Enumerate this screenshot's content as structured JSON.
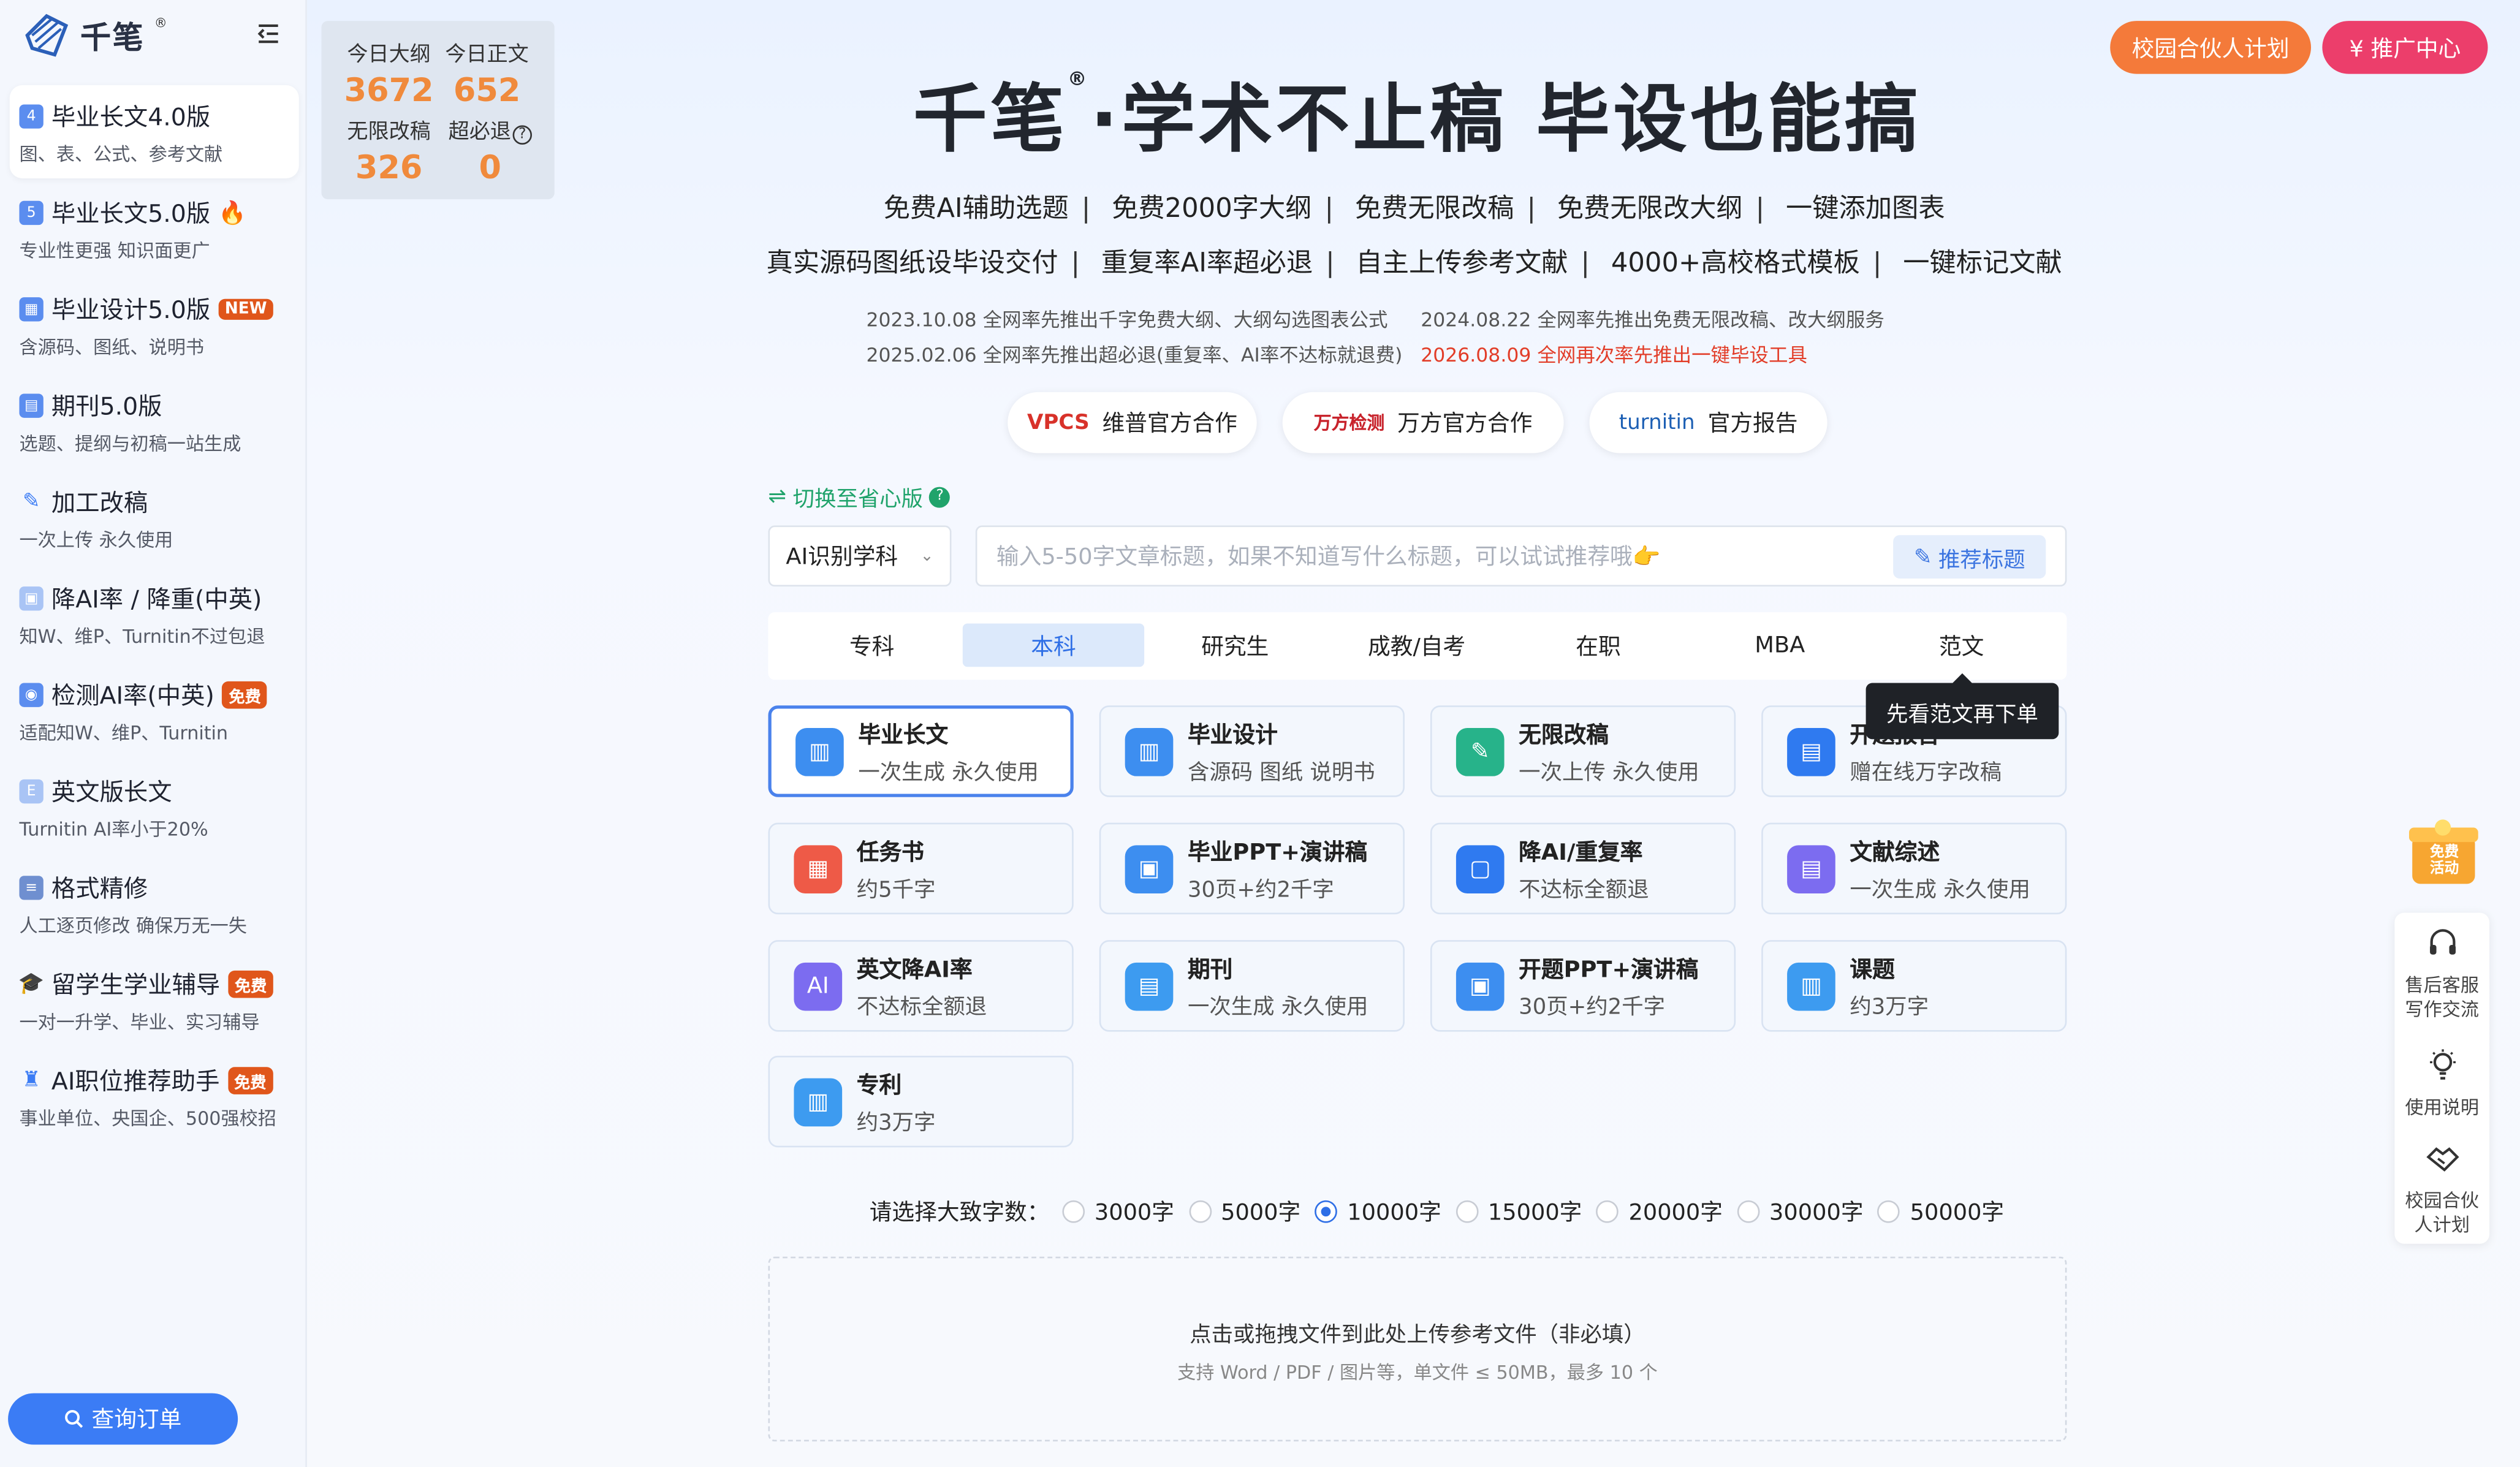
{
  "logo": {
    "text": "千笔",
    "reg": "®"
  },
  "sidebar": {
    "items": [
      {
        "label": "毕业长文4.0版",
        "sub": "图、表、公式、参考文献",
        "icon_text": "4"
      },
      {
        "label": "毕业长文5.0版",
        "sub": "专业性更强 知识面更广",
        "icon_text": "5"
      },
      {
        "label": "毕业设计5.0版",
        "sub": "含源码、图纸、说明书",
        "badge": "NEW"
      },
      {
        "label": "期刊5.0版",
        "sub": "选题、提纲与初稿一站生成"
      },
      {
        "label": "加工改稿",
        "sub": "一次上传 永久使用"
      },
      {
        "label": "降AI率 / 降重(中英)",
        "sub": "知W、维P、Turnitin不过包退"
      },
      {
        "label": "检测AI率(中英)",
        "sub": "适配知W、维P、Turnitin",
        "badge": "免费"
      },
      {
        "label": "英文版长文",
        "sub": "Turnitin AI率小于20%"
      },
      {
        "label": "格式精修",
        "sub": "人工逐页修改 确保万无一失"
      },
      {
        "label": "留学生学业辅导",
        "sub": "一对一升学、毕业、实习辅导",
        "badge": "免费"
      },
      {
        "label": "AI职位推荐助手",
        "sub": "事业单位、央国企、500强校招",
        "badge": "免费"
      }
    ],
    "query_button": "查询订单"
  },
  "stats": {
    "today_outline_label": "今日大纲",
    "today_outline_value": "3672",
    "today_text_label": "今日正文",
    "today_text_value": "652",
    "unlimited_label": "无限改稿",
    "unlimited_value": "326",
    "refund_label": "超必退",
    "refund_value": "0"
  },
  "top_buttons": {
    "campus": "校园合伙人计划",
    "promo": "¥  推广中心"
  },
  "hero": {
    "title_a": "千笔",
    "title_reg": "®",
    "title_b": "·学术不止稿  毕设也能搞",
    "features1": [
      "免费AI辅助选题",
      "免费2000字大纲",
      "免费无限改稿",
      "免费无限改大纲",
      "一键添加图表"
    ],
    "features2": [
      "真实源码图纸设毕设交付",
      "重复率AI率超必退",
      "自主上传参考文献",
      "4000+高校格式模板",
      "一键标记文献"
    ],
    "news": [
      "2023.10.08 全网率先推出千字免费大纲、大纲勾选图表公式",
      "2024.08.22 全网率先推出免费无限改稿、改大纲服务",
      "2025.02.06 全网率先推出超必退(重复率、AI率不达标就退费)",
      "2026.08.09 全网再次率先推出一键毕设工具"
    ]
  },
  "partners": [
    {
      "logo": "VPCS",
      "label": "维普官方合作"
    },
    {
      "logo": "万方检测",
      "label": "万方官方合作"
    },
    {
      "logo": "turnitin",
      "label": "官方报告"
    }
  ],
  "switch_label": "切换至省心版",
  "subject_select": "AI识别学科",
  "title_input": {
    "placeholder": "输入5-50字文章标题，如果不知道写什么标题，可以试试推荐哦👉"
  },
  "recommend_button": "推荐标题",
  "tabs": [
    "专科",
    "本科",
    "研究生",
    "成教/自考",
    "在职",
    "MBA",
    "范文"
  ],
  "active_tab": "本科",
  "tooltip": "先看范文再下单",
  "cards": [
    {
      "title": "毕业长文",
      "sub": "一次生成 永久使用",
      "color": "#3d8ef0"
    },
    {
      "title": "毕业设计",
      "sub": "含源码 图纸 说明书",
      "color": "#3d8ef0"
    },
    {
      "title": "无限改稿",
      "sub": "一次上传 永久使用",
      "color": "#27b38a"
    },
    {
      "title": "开题报告",
      "sub": "赠在线万字改稿",
      "color": "#2f7af0"
    },
    {
      "title": "任务书",
      "sub": "约5千字",
      "color": "#ee5a47"
    },
    {
      "title": "毕业PPT+演讲稿",
      "sub": "30页+约2千字",
      "color": "#3d8ef0"
    },
    {
      "title": "降AI/重复率",
      "sub": "不达标全额退",
      "color": "#2f7af0"
    },
    {
      "title": "文献综述",
      "sub": "一次生成 永久使用",
      "color": "#7c6cf0"
    },
    {
      "title": "英文降AI率",
      "sub": "不达标全额退",
      "color": "#7c6cf0"
    },
    {
      "title": "期刊",
      "sub": "一次生成 永久使用",
      "color": "#3d9bf0"
    },
    {
      "title": "开题PPT+演讲稿",
      "sub": "30页+约2千字",
      "color": "#3d8ef0"
    },
    {
      "title": "课题",
      "sub": "约3万字",
      "color": "#3d9bf0"
    },
    {
      "title": "专利",
      "sub": "约3万字",
      "color": "#3d9bf0"
    }
  ],
  "wordcount": {
    "label": "请选择大致字数：",
    "options": [
      "3000字",
      "5000字",
      "10000字",
      "15000字",
      "20000字",
      "30000字",
      "50000字"
    ],
    "selected": "10000字"
  },
  "upload": {
    "main": "点击或拖拽文件到此处上传参考文件（非必填）",
    "sub": "支持 Word / PDF / 图片等，单文件 ≤ 50MB，最多 10 个"
  },
  "float_panel": {
    "gift_text": "免费活动",
    "service": "售后客服写作交流",
    "service_l1": "售后客服",
    "service_l2": "写作交流",
    "guide": "使用说明",
    "partner_l1": "校园合伙",
    "partner_l2": "人计划"
  },
  "colors": {
    "accent": "#3b7cf5",
    "orange": "#f08a3c",
    "pink": "#ec3e6b",
    "green": "#20a36b"
  }
}
